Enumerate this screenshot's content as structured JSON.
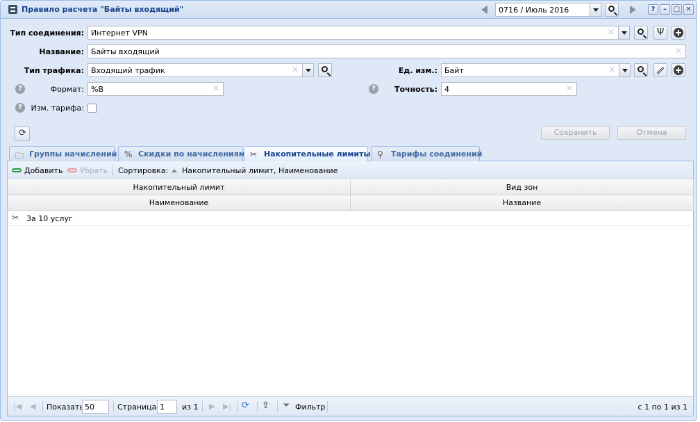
{
  "window": {
    "title": "Правило расчета \"Байты входящий\"",
    "period": "0716 / Июль 2016",
    "help_label": "?",
    "minimize_label": "–",
    "maximize_label": "□",
    "close_label": "✕"
  },
  "form": {
    "connection_type": {
      "label": "Тип соединения:",
      "value": "Интернет VPN"
    },
    "name": {
      "label": "Название:",
      "value": "Байты входящий"
    },
    "traffic_type": {
      "label": "Тип трафика:",
      "value": "Входящий трафик"
    },
    "unit": {
      "label": "Ед. изм.:",
      "value": "Байт"
    },
    "format": {
      "label": "Формат:",
      "value": "%B"
    },
    "precision": {
      "label": "Точность:",
      "value": "4"
    },
    "tariff_change": {
      "label": "Изм. тарифа:",
      "checked": false
    }
  },
  "actions": {
    "save": "Сохранить",
    "cancel": "Отмена"
  },
  "tabs": [
    {
      "label": "Группы начислений",
      "icon": "folder-icon",
      "active": false
    },
    {
      "label": "Скидки по начислениям",
      "icon": "percent-icon",
      "active": false
    },
    {
      "label": "Накопительные лимиты",
      "icon": "scissors-icon",
      "active": true
    },
    {
      "label": "Тарифы соединений",
      "icon": "network-icon",
      "active": false
    }
  ],
  "toolbar": {
    "add": "Добавить",
    "remove": "Убрать",
    "sort_label": "Сортировка:",
    "sort_value": "Накопительный лимит, Наименование"
  },
  "grid": {
    "group_headers": [
      "Накопительный лимит",
      "Вид зон"
    ],
    "columns": [
      "Наименование",
      "Название"
    ],
    "rows": [
      {
        "name": "За 10 услуг",
        "zone": ""
      }
    ]
  },
  "pager": {
    "show_label": "Показать",
    "page_size": "50",
    "page_label": "Страница",
    "page": "1",
    "of_pages": "из 1",
    "filter": "Фильтр",
    "summary": "с 1 по 1 из 1"
  }
}
